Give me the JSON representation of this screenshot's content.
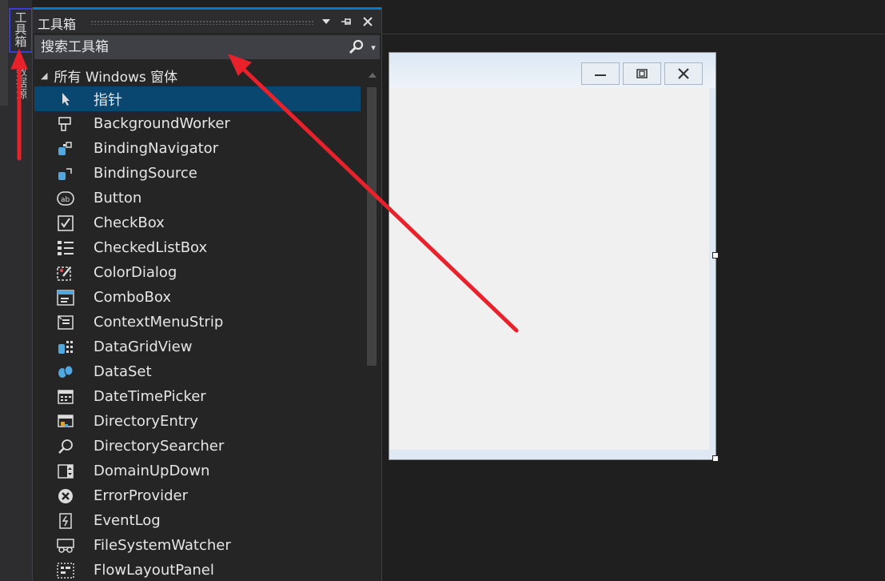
{
  "side_tabs": [
    {
      "label": "工具箱"
    },
    {
      "label": "数据源"
    }
  ],
  "toolbox": {
    "title": "工具箱",
    "search_placeholder": "搜索工具箱",
    "section_label": "所有 Windows 窗体",
    "items": [
      {
        "label": "指针",
        "icon": "pointer-icon",
        "selected": true
      },
      {
        "label": "BackgroundWorker",
        "icon": "background-worker-icon"
      },
      {
        "label": "BindingNavigator",
        "icon": "binding-navigator-icon"
      },
      {
        "label": "BindingSource",
        "icon": "binding-source-icon"
      },
      {
        "label": "Button",
        "icon": "button-icon"
      },
      {
        "label": "CheckBox",
        "icon": "checkbox-icon"
      },
      {
        "label": "CheckedListBox",
        "icon": "checked-listbox-icon"
      },
      {
        "label": "ColorDialog",
        "icon": "color-dialog-icon"
      },
      {
        "label": "ComboBox",
        "icon": "combobox-icon"
      },
      {
        "label": "ContextMenuStrip",
        "icon": "context-menu-strip-icon"
      },
      {
        "label": "DataGridView",
        "icon": "datagridview-icon"
      },
      {
        "label": "DataSet",
        "icon": "dataset-icon"
      },
      {
        "label": "DateTimePicker",
        "icon": "datetimepicker-icon"
      },
      {
        "label": "DirectoryEntry",
        "icon": "directory-entry-icon"
      },
      {
        "label": "DirectorySearcher",
        "icon": "directory-searcher-icon"
      },
      {
        "label": "DomainUpDown",
        "icon": "domain-updown-icon"
      },
      {
        "label": "ErrorProvider",
        "icon": "error-provider-icon"
      },
      {
        "label": "EventLog",
        "icon": "eventlog-icon"
      },
      {
        "label": "FileSystemWatcher",
        "icon": "filesystemwatcher-icon"
      },
      {
        "label": "FlowLayoutPanel",
        "icon": "flowlayoutpanel-icon"
      }
    ]
  },
  "colors": {
    "panel_bg": "#252526",
    "selection": "#094771",
    "accent": "#007acc",
    "annotation": "#e8212b",
    "icon_blue": "#4fa8e0"
  }
}
